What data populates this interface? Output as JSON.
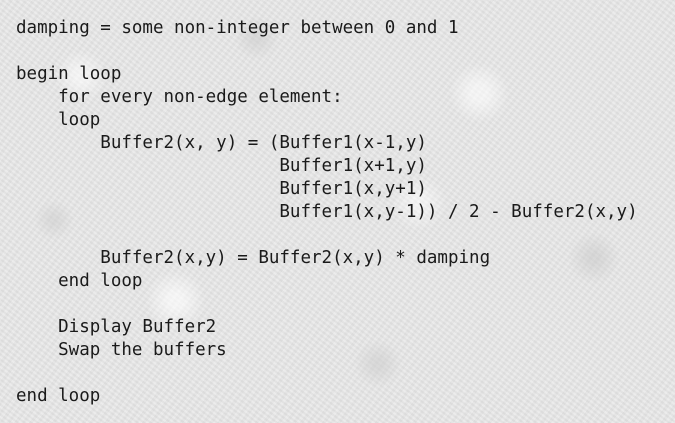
{
  "document": {
    "lines": [
      "damping = some non-integer between 0 and 1",
      "",
      "begin loop",
      "    for every non-edge element:",
      "    loop",
      "        Buffer2(x, y) = (Buffer1(x-1,y)",
      "                         Buffer1(x+1,y)",
      "                         Buffer1(x,y+1)",
      "                         Buffer1(x,y-1)) / 2 - Buffer2(x,y)",
      "",
      "        Buffer2(x,y) = Buffer2(x,y) * damping",
      "    end loop",
      "",
      "    Display Buffer2",
      "    Swap the buffers",
      "",
      "end loop"
    ]
  }
}
